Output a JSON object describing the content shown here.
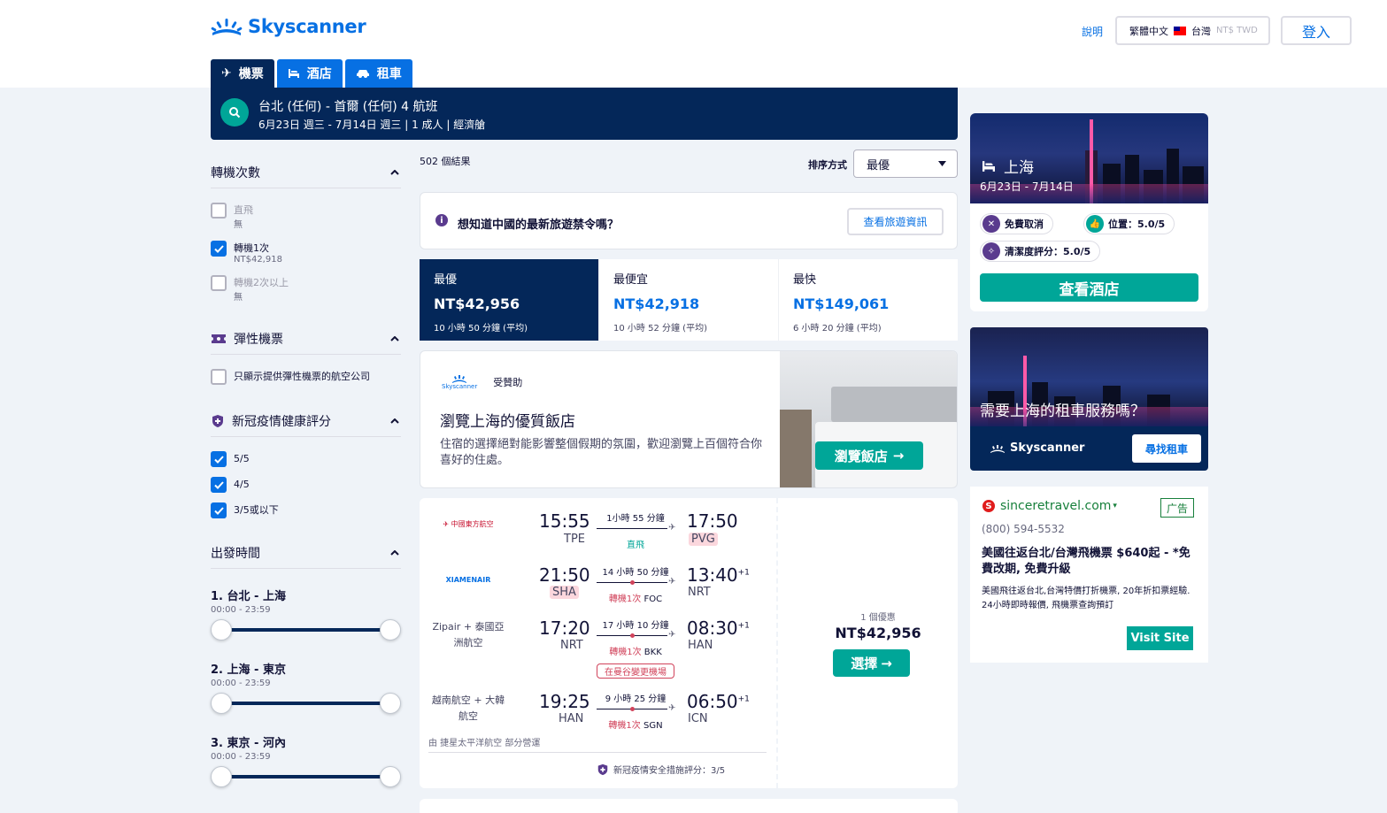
{
  "header": {
    "brand": "Skyscanner",
    "help": "說明",
    "language": "繁體中文",
    "region": "台灣",
    "currency": "NT$ TWD",
    "login": "登入"
  },
  "tabs": [
    {
      "label": "機票",
      "icon": "plane-icon"
    },
    {
      "label": "酒店",
      "icon": "bed-icon"
    },
    {
      "label": "租車",
      "icon": "car-icon"
    }
  ],
  "search": {
    "route": "台北 (任何) - 首爾 (任何) 4 航班",
    "meta": "6月23日 週三 - 7月14日 週三 | 1 成人 | 經濟艙"
  },
  "filters": {
    "stops": {
      "title": "轉機次數",
      "options": [
        {
          "label": "直飛",
          "sub": "無",
          "checked": false
        },
        {
          "label": "轉機1次",
          "sub": "NT$42,918",
          "checked": true
        },
        {
          "label": "轉機2次以上",
          "sub": "無",
          "checked": false
        }
      ]
    },
    "flex": {
      "title": "彈性機票",
      "option": "只顯示提供彈性機票的航空公司"
    },
    "covid": {
      "title": "新冠疫情健康評分",
      "options": [
        "5/5",
        "4/5",
        "3/5或以下"
      ]
    },
    "times": {
      "title": "出發時間",
      "legs": [
        {
          "title": "1. 台北 - 上海",
          "range": "00:00 - 23:59"
        },
        {
          "title": "2. 上海 - 東京",
          "range": "00:00 - 23:59"
        },
        {
          "title": "3. 東京 - 河內",
          "range": "00:00 - 23:59"
        }
      ]
    }
  },
  "results": {
    "count": "502 個結果",
    "sort_label": "排序方式",
    "sort_value": "最優"
  },
  "notice": {
    "text": "想知道中國的最新旅遊禁令嗎？",
    "button": "查看旅遊資訊"
  },
  "sort_tabs": [
    {
      "name": "最優",
      "price": "NT$42,956",
      "duration": "10 小時 50 分鐘 (平均)"
    },
    {
      "name": "最便宜",
      "price": "NT$42,918",
      "duration": "10 小時 52 分鐘 (平均)"
    },
    {
      "name": "最快",
      "price": "NT$149,061",
      "duration": "6 小時 20 分鐘 (平均)"
    }
  ],
  "promo": {
    "logo": "Skyscanner",
    "sponsored": "受贊助",
    "title": "瀏覽上海的優質飯店",
    "desc": "住宿的選擇絕對能影響整個假期的氛圍，歡迎瀏覽上百個符合你喜好的住處。",
    "cta": "瀏覽飯店"
  },
  "itinerary": {
    "legs": [
      {
        "airline": "中國東方航空",
        "dep": "15:55",
        "dep_code": "TPE",
        "duration": "1小時 55 分鐘",
        "stops": "直飛",
        "stop_code": "",
        "arr": "17:50",
        "arr_code": "PVG",
        "plus": ""
      },
      {
        "airline": "XIAMENAIR",
        "dep": "21:50",
        "dep_code": "SHA",
        "duration": "14 小時 50 分鐘",
        "stops": "轉機1次",
        "stop_code": "FOC",
        "arr": "13:40",
        "arr_code": "NRT",
        "plus": "+1"
      },
      {
        "airline": "Zipair + 泰國亞洲航空",
        "dep": "17:20",
        "dep_code": "NRT",
        "duration": "17 小時 10 分鐘",
        "stops": "轉機1次",
        "stop_code": "BKK",
        "arr": "08:30",
        "arr_code": "HAN",
        "plus": "+1"
      },
      {
        "airline": "越南航空 + 大韓航空",
        "dep": "19:25",
        "dep_code": "HAN",
        "duration": "9 小時 25 分鐘",
        "stops": "轉機1次",
        "stop_code": "SGN",
        "arr": "06:50",
        "arr_code": "ICN",
        "plus": "+1"
      }
    ],
    "change_airport": "在曼谷變更機場",
    "operated": "由 捷星太平洋航空 部分營運",
    "covid_score": "新冠疫情安全措施評分：3/5",
    "deals": "1 個優惠",
    "price": "NT$42,956",
    "select": "選擇"
  },
  "hotel_card": {
    "city": "上海",
    "dates": "6月23日 - 7月14日",
    "free_cancel": "免費取消",
    "location": "位置：5.0/5",
    "cleanliness": "清潔度評分：5.0/5",
    "cta": "查看酒店"
  },
  "car_card": {
    "question": "需要上海的租車服務嗎？",
    "logo": "Skyscanner",
    "cta": "尋找租車"
  },
  "ad": {
    "domain": "sinceretravel.com",
    "marker": "▾",
    "tag": "广告",
    "phone": "(800) 594-5532",
    "headline": "美國往返台北/台灣飛機票 $640起 - *免費改期, 免費升級",
    "body": "美國飛往返台北,台灣特價打折機票, 20年折扣票經驗. 24小時即時報價, 飛機票查詢預訂",
    "cta": "Visit Site"
  },
  "colors": {
    "brand_blue": "#0770e3",
    "navy": "#042759",
    "teal": "#00a698",
    "red": "#d1435b"
  }
}
